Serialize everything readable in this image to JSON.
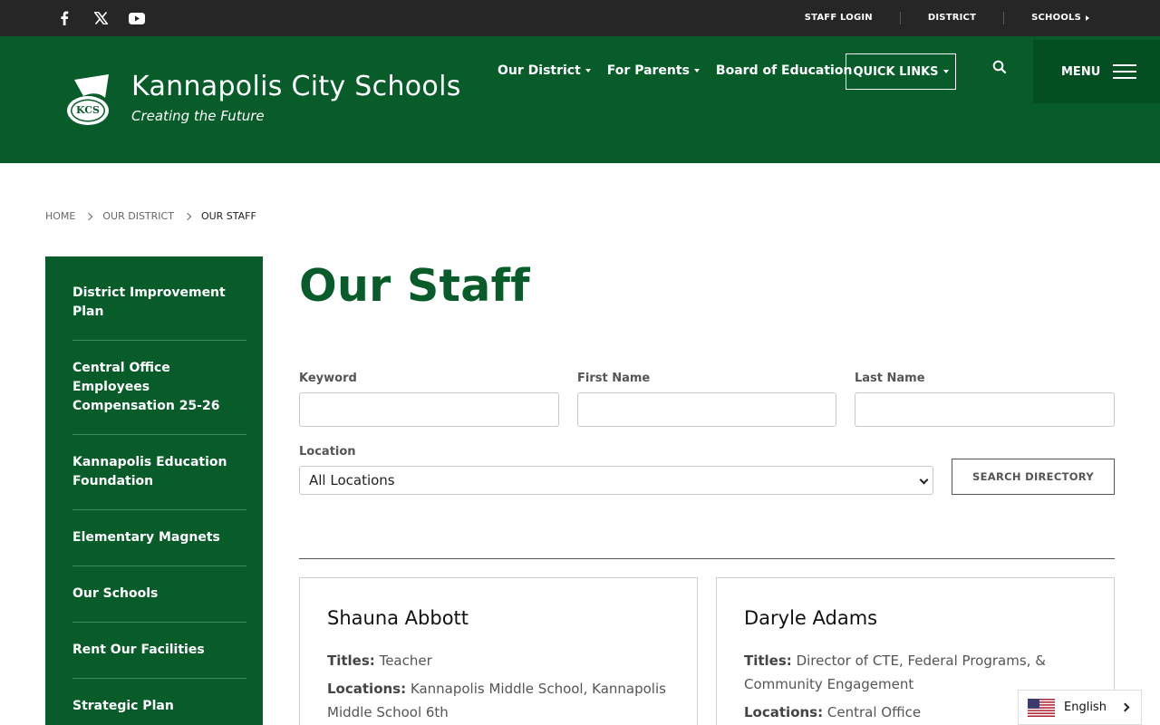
{
  "topbar": {
    "social": [
      "facebook-icon",
      "x-icon",
      "youtube-icon"
    ],
    "links": [
      "STAFF LOGIN",
      "DISTRICT",
      "SCHOOLS"
    ]
  },
  "header": {
    "brand_name": "Kannapolis City Schools",
    "brand_tag": "Creating the Future",
    "nav": [
      "Our District",
      "For Parents",
      "Board of Education"
    ],
    "quick_links": "QUICK LINKS",
    "menu": "MENU"
  },
  "breadcrumb": [
    "HOME",
    "OUR DISTRICT",
    "OUR STAFF"
  ],
  "sidebar": {
    "items": [
      "District Improvement Plan",
      "Central Office Employees Compensation 25-26",
      "Kannapolis Education Foundation",
      "Elementary Magnets",
      "Our Schools",
      "Rent Our Facilities",
      "Strategic Plan"
    ]
  },
  "main": {
    "title": "Our Staff",
    "form": {
      "keyword_label": "Keyword",
      "keyword_value": "",
      "first_name_label": "First Name",
      "first_name_value": "",
      "last_name_label": "Last Name",
      "last_name_value": "",
      "location_label": "Location",
      "location_value": "All Locations",
      "submit": "SEARCH DIRECTORY"
    },
    "cards": [
      {
        "name": "Shauna Abbott",
        "titles_label": "Titles:",
        "titles": "Teacher",
        "locations_label": "Locations:",
        "locations": "Kannapolis Middle School, Kannapolis Middle School 6th"
      },
      {
        "name": "Daryle Adams",
        "titles_label": "Titles:",
        "titles": "Director of CTE, Federal Programs, & Community Engagement",
        "locations_label": "Locations:",
        "locations": "Central Office"
      }
    ]
  },
  "language": {
    "label": "English",
    "flag": "us-flag-icon"
  },
  "colors": {
    "brand_green": "#075c2a",
    "topbar": "#262626",
    "menu_bg": "#034f22"
  }
}
